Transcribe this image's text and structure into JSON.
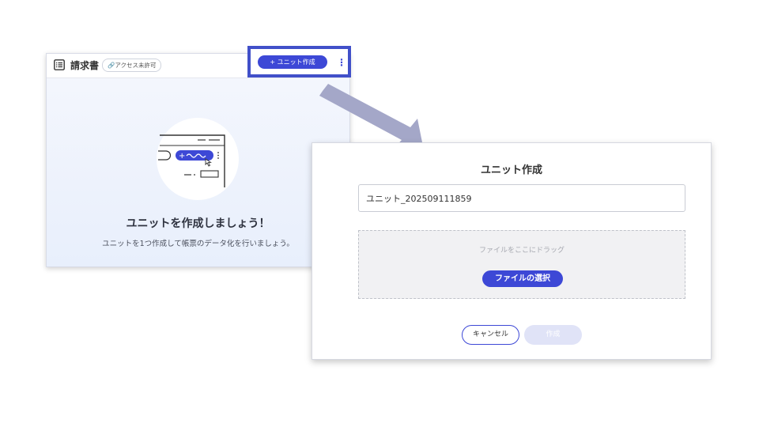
{
  "left_panel": {
    "title": "請求書",
    "access_badge": "🔗アクセス未許可",
    "create_unit_button": "+ ユニット作成",
    "empty_state": {
      "title": "ユニットを作成しましょう！",
      "description": "ユニットを1つ作成して帳票のデータ化を行いましょう。"
    },
    "icons": {
      "document": "list-document-icon",
      "more": "kebab-icon",
      "link": "link-icon"
    }
  },
  "dialog": {
    "title": "ユニット作成",
    "unit_name_value": "ユニット_202509111859",
    "dropzone_text": "ファイルをここにドラッグ",
    "select_file_button": "ファイルの選択",
    "cancel_button": "キャンセル",
    "submit_button": "作成"
  },
  "colors": {
    "accent": "#3d48d6",
    "highlight": "#4150c9",
    "arrow": "#a4a7c8",
    "submit_disabled": "#e0e3f7"
  }
}
